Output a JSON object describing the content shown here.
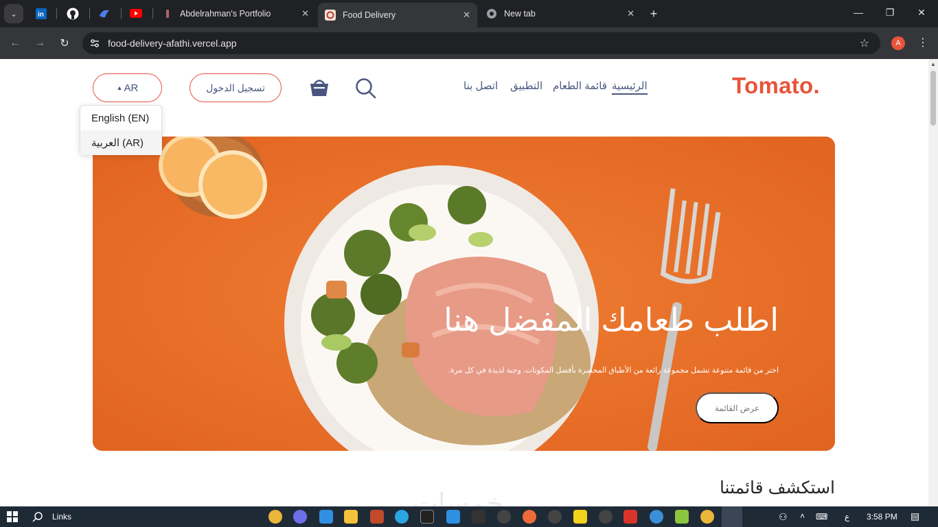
{
  "browser": {
    "tabs": [
      {
        "title": "Abdelrahman's Portfolio",
        "active": false
      },
      {
        "title": "Food Delivery",
        "active": true
      },
      {
        "title": "New tab",
        "active": false
      }
    ],
    "url": "food-delivery-afathi.vercel.app",
    "profile_initial": "A",
    "new_tab_symbol": "+",
    "tab_close_symbol": "✕"
  },
  "site": {
    "logo": "Tomato.",
    "nav": [
      "الرئيسية",
      "قائمة الطعام",
      "التطبيق",
      "اتصل بنا"
    ],
    "active_nav": "الرئيسية",
    "signin_label": "تسجيل الدخول",
    "lang_label": "AR",
    "lang_options": [
      "English (EN)",
      "العربية (AR)"
    ],
    "hero": {
      "title": "اطلب طعامك المفضل هنا",
      "subtitle": "اختر من قائمة متنوعة تشمل مجموعة رائعة من الأطباق المحضرة بأفضل المكونات. وجبة لذيذة في كل مرة.",
      "button": "عرض القائمة"
    },
    "explore_heading": "استكشف قائمتنا",
    "watermark": "خمسات"
  },
  "taskbar": {
    "search_label": "Links",
    "time": "3:58 PM",
    "lang_indicator": "ع"
  },
  "colors": {
    "brand": "#e8543b",
    "nav_text": "#49557e",
    "hero_bg": "#e8712a"
  }
}
